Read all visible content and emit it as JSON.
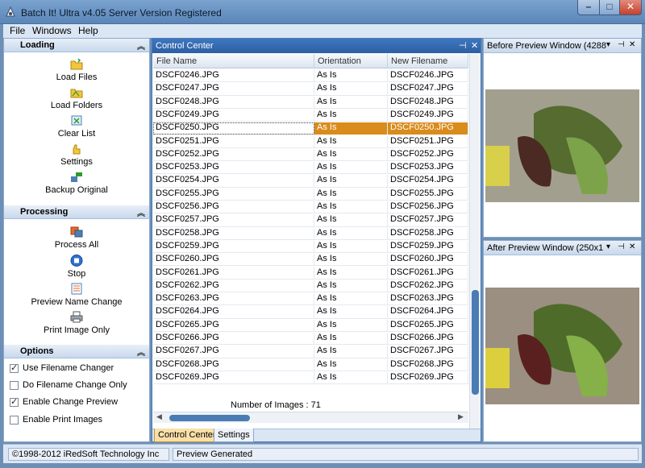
{
  "window": {
    "title": "Batch It! Ultra v4.05 Server Version Registered"
  },
  "menu": [
    "File",
    "Windows",
    "Help"
  ],
  "left_panel": {
    "loading": {
      "title": "Loading",
      "tools": [
        "Load Files",
        "Load Folders",
        "Clear List",
        "Settings",
        "Backup Original"
      ]
    },
    "processing": {
      "title": "Processing",
      "tools": [
        "Process All",
        "Stop",
        "Preview Name Change",
        "Print Image Only"
      ]
    },
    "options": {
      "title": "Options",
      "items": [
        {
          "label": "Use Filename Changer",
          "checked": true
        },
        {
          "label": "Do Filename Change Only",
          "checked": false
        },
        {
          "label": "Enable Change Preview",
          "checked": true
        },
        {
          "label": "Enable Print Images",
          "checked": false
        }
      ]
    }
  },
  "control_center": {
    "title": "Control Center",
    "columns": [
      "File Name",
      "Orientation",
      "New Filename"
    ],
    "rows": [
      [
        "DSCF0246.JPG",
        "As Is",
        "DSCF0246.JPG"
      ],
      [
        "DSCF0247.JPG",
        "As Is",
        "DSCF0247.JPG"
      ],
      [
        "DSCF0248.JPG",
        "As Is",
        "DSCF0248.JPG"
      ],
      [
        "DSCF0249.JPG",
        "As Is",
        "DSCF0249.JPG"
      ],
      [
        "DSCF0250.JPG",
        "As Is",
        "DSCF0250.JPG"
      ],
      [
        "DSCF0251.JPG",
        "As Is",
        "DSCF0251.JPG"
      ],
      [
        "DSCF0252.JPG",
        "As Is",
        "DSCF0252.JPG"
      ],
      [
        "DSCF0253.JPG",
        "As Is",
        "DSCF0253.JPG"
      ],
      [
        "DSCF0254.JPG",
        "As Is",
        "DSCF0254.JPG"
      ],
      [
        "DSCF0255.JPG",
        "As Is",
        "DSCF0255.JPG"
      ],
      [
        "DSCF0256.JPG",
        "As Is",
        "DSCF0256.JPG"
      ],
      [
        "DSCF0257.JPG",
        "As Is",
        "DSCF0257.JPG"
      ],
      [
        "DSCF0258.JPG",
        "As Is",
        "DSCF0258.JPG"
      ],
      [
        "DSCF0259.JPG",
        "As Is",
        "DSCF0259.JPG"
      ],
      [
        "DSCF0260.JPG",
        "As Is",
        "DSCF0260.JPG"
      ],
      [
        "DSCF0261.JPG",
        "As Is",
        "DSCF0261.JPG"
      ],
      [
        "DSCF0262.JPG",
        "As Is",
        "DSCF0262.JPG"
      ],
      [
        "DSCF0263.JPG",
        "As Is",
        "DSCF0263.JPG"
      ],
      [
        "DSCF0264.JPG",
        "As Is",
        "DSCF0264.JPG"
      ],
      [
        "DSCF0265.JPG",
        "As Is",
        "DSCF0265.JPG"
      ],
      [
        "DSCF0266.JPG",
        "As Is",
        "DSCF0266.JPG"
      ],
      [
        "DSCF0267.JPG",
        "As Is",
        "DSCF0267.JPG"
      ],
      [
        "DSCF0268.JPG",
        "As Is",
        "DSCF0268.JPG"
      ],
      [
        "DSCF0269.JPG",
        "As Is",
        "DSCF0269.JPG"
      ]
    ],
    "selected_row": 4,
    "image_count": "Number of Images : 71",
    "tabs": [
      "Control Center",
      "Settings"
    ],
    "active_tab": 0
  },
  "before_preview": {
    "title": "Before Preview Window (4288"
  },
  "after_preview": {
    "title": "After Preview Window (250x1"
  },
  "status": {
    "copyright": "©1998-2012 iRedSoft Technology Inc",
    "message": "Preview Generated"
  },
  "colors": {
    "selection": "#d98b1b",
    "panel_header": "#3f77c0",
    "accent": "#4a7bb5"
  }
}
